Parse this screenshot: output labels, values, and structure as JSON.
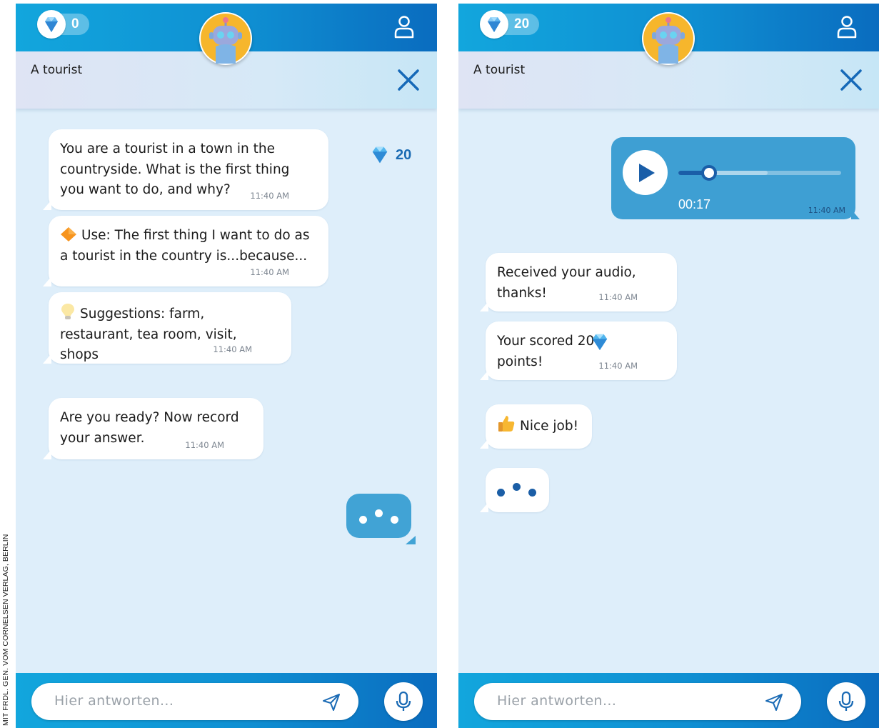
{
  "credit": "MIT FRDL. GEN. VOM CORNELSEN VERLAG, BERLIN",
  "left": {
    "gem_count": "0",
    "title": "A tourist",
    "score": "20",
    "messages": [
      {
        "text": "You are a tourist in a town in the\ncountryside. What is the first thing\nyou want to do, and why?",
        "time": "11:40 AM"
      },
      {
        "text": "Use: The first thing I want to do as\na tourist in the country is...because...",
        "time": "11:40 AM",
        "icon": "orange-diamond-icon"
      },
      {
        "text": "Suggestions: farm,\nrestaurant, tea room, visit,\nshops",
        "time": "11:40 AM",
        "icon": "lightbulb-icon"
      },
      {
        "text": "Are you ready? Now record\nyour answer.",
        "time": "11:40 AM"
      }
    ],
    "input_placeholder": "Hier antworten..."
  },
  "right": {
    "gem_count": "20",
    "title": "A tourist",
    "audio": {
      "duration": "00:17",
      "time": "11:40 AM",
      "progress": 0.19,
      "buffered": 0.55
    },
    "messages": [
      {
        "text": "Received your audio,\nthanks!",
        "time": "11:40 AM"
      },
      {
        "text": "Your scored 20\npoints!",
        "time": "11:40 AM",
        "icon": "gem-icon"
      },
      {
        "text": "Nice job!",
        "icon": "thumbs-up-icon"
      }
    ],
    "input_placeholder": "Hier antworten..."
  },
  "colors": {
    "bar_start": "#12a6dd",
    "bar_end": "#0a6cbf",
    "chat_bg": "#deeefa",
    "accent_blue": "#1a6bb3",
    "user_bubble": "#41a3d5"
  }
}
